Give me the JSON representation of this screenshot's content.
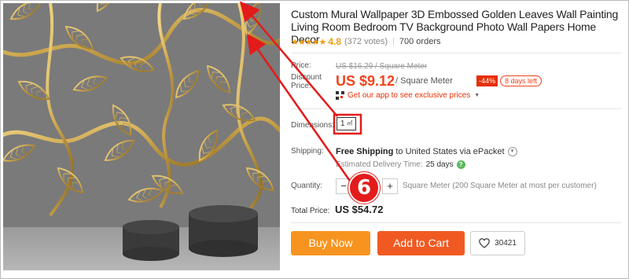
{
  "product": {
    "title": "Custom Mural Wallpaper 3D Embossed Golden Leaves Wall Painting Living Room Bedroom TV Background Photo Wall Papers Home Decor",
    "stars": "★★★★★",
    "rating": "4.8",
    "votes": "(372 votes)",
    "orders": "700 orders"
  },
  "pricing": {
    "price_label": "Price:",
    "original_price": "US $16.29 / Square Meter",
    "discount_label": "Discount Price:",
    "current_price": "US $9.12",
    "unit": "/ Square Meter",
    "discount_badge": "-44%",
    "days_left": "8 days left",
    "app_promo": "Get our app to see exclusive prices",
    "app_promo_arrow": "▼"
  },
  "dimensions": {
    "label": "Dimensions:",
    "value": "1",
    "unit": "㎡"
  },
  "shipping": {
    "label": "Shipping:",
    "free": "Free Shipping",
    "dest": "to United States via ePacket",
    "est_label": "Estimated Delivery Time:",
    "est_days": "25 days",
    "help_icon": "?"
  },
  "quantity": {
    "label": "Quantity:",
    "minus": "−",
    "value": "",
    "plus": "+",
    "note": "Square Meter (200 Square Meter at most per customer)"
  },
  "total": {
    "label": "Total Price:",
    "value": "US  $54.72"
  },
  "actions": {
    "buy_now": "Buy Now",
    "add_to_cart": "Add to Cart",
    "wishlist_count": "30421"
  },
  "annotation": {
    "step_number": "6",
    "color": "#e31b1b"
  },
  "colors": {
    "price_red": "#f0441c",
    "buy_orange": "#f79420",
    "cart_orange": "#f05a22",
    "star_gold": "#f39a0b"
  }
}
